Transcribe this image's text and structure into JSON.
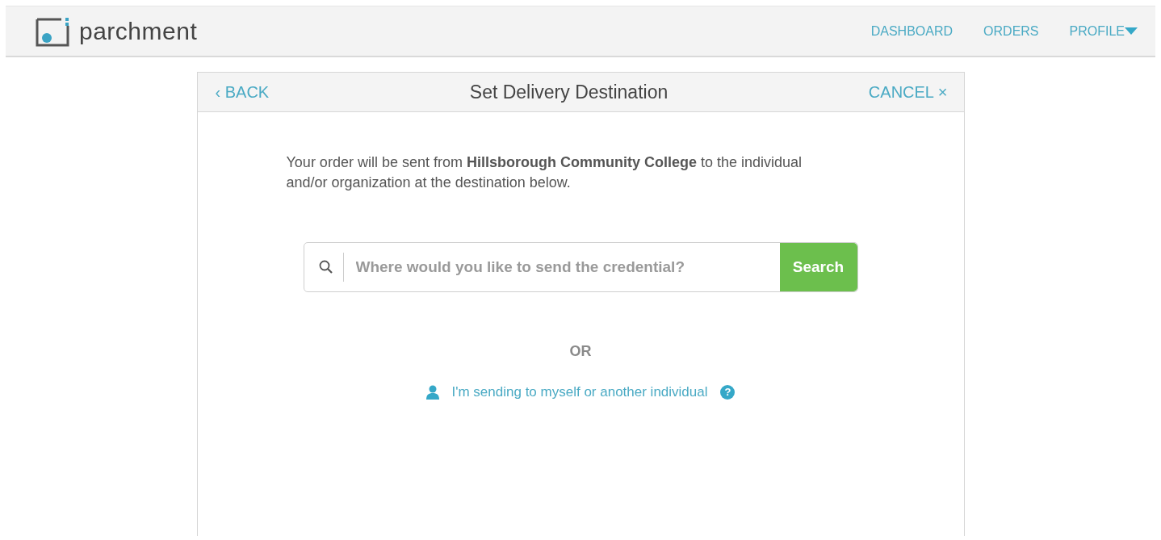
{
  "header": {
    "logo_text": "parchment",
    "nav": [
      {
        "label": "DASHBOARD",
        "kind": "link"
      },
      {
        "label": "ORDERS",
        "kind": "link"
      },
      {
        "label": "PROFILE",
        "kind": "dropdown"
      }
    ]
  },
  "card": {
    "back": {
      "icon": "‹",
      "label": "BACK"
    },
    "title": "Set Delivery Destination",
    "cancel": {
      "label": "CANCEL",
      "icon": "×"
    },
    "intro": "Your order will be sent from **Hillsborough Community College** to the individual and/or organization at the destination below.",
    "search": {
      "placeholder": "Where would you like to send the credential?",
      "button": "Search"
    },
    "divider_text": "OR",
    "individual_link": "I'm sending to myself or another individual",
    "help_icon": "?"
  }
}
